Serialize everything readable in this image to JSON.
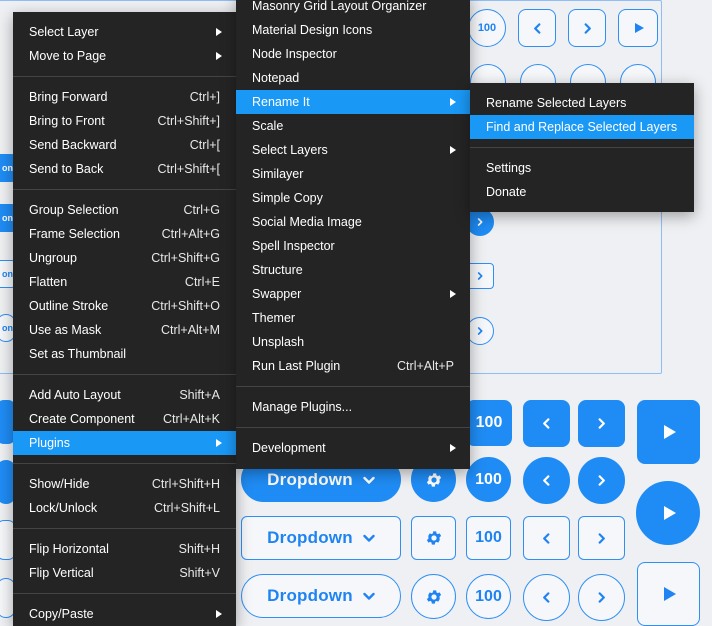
{
  "canvas": {
    "row1": {
      "num": "100"
    },
    "row3": {
      "dropdown": "Dropdown",
      "num": "100"
    },
    "row4": {
      "dropdown": "Dropdown",
      "num": "100"
    },
    "row5": {
      "dropdown": "Dropdown",
      "num": "100"
    },
    "partial_labels": [
      "on",
      "on",
      "on",
      "on"
    ],
    "accent_color": "#1f8cf5"
  },
  "context_menu": {
    "items": [
      {
        "label": "Select Layer",
        "shortcut": "",
        "submenu": true
      },
      {
        "label": "Move to Page",
        "shortcut": "",
        "submenu": true
      },
      {
        "sep": true
      },
      {
        "label": "Bring Forward",
        "shortcut": "Ctrl+]"
      },
      {
        "label": "Bring to Front",
        "shortcut": "Ctrl+Shift+]"
      },
      {
        "label": "Send Backward",
        "shortcut": "Ctrl+["
      },
      {
        "label": "Send to Back",
        "shortcut": "Ctrl+Shift+["
      },
      {
        "sep": true
      },
      {
        "label": "Group Selection",
        "shortcut": "Ctrl+G"
      },
      {
        "label": "Frame Selection",
        "shortcut": "Ctrl+Alt+G"
      },
      {
        "label": "Ungroup",
        "shortcut": "Ctrl+Shift+G"
      },
      {
        "label": "Flatten",
        "shortcut": "Ctrl+E"
      },
      {
        "label": "Outline Stroke",
        "shortcut": "Ctrl+Shift+O"
      },
      {
        "label": "Use as Mask",
        "shortcut": "Ctrl+Alt+M"
      },
      {
        "label": "Set as Thumbnail",
        "shortcut": ""
      },
      {
        "sep": true
      },
      {
        "label": "Add Auto Layout",
        "shortcut": "Shift+A"
      },
      {
        "label": "Create Component",
        "shortcut": "Ctrl+Alt+K"
      },
      {
        "label": "Plugins",
        "shortcut": "",
        "submenu": true,
        "active": true
      },
      {
        "sep": true
      },
      {
        "label": "Show/Hide",
        "shortcut": "Ctrl+Shift+H"
      },
      {
        "label": "Lock/Unlock",
        "shortcut": "Ctrl+Shift+L"
      },
      {
        "sep": true
      },
      {
        "label": "Flip Horizontal",
        "shortcut": "Shift+H"
      },
      {
        "label": "Flip Vertical",
        "shortcut": "Shift+V"
      },
      {
        "sep": true
      },
      {
        "label": "Copy/Paste",
        "shortcut": "",
        "submenu": true
      }
    ]
  },
  "plugins_menu": {
    "items": [
      {
        "label": "Masonry Grid Layout Organizer"
      },
      {
        "label": "Material Design Icons"
      },
      {
        "label": "Node Inspector"
      },
      {
        "label": "Notepad"
      },
      {
        "label": "Rename It",
        "submenu": true,
        "active": true
      },
      {
        "label": "Scale"
      },
      {
        "label": "Select Layers",
        "submenu": true
      },
      {
        "label": "Similayer"
      },
      {
        "label": "Simple Copy"
      },
      {
        "label": "Social Media Image"
      },
      {
        "label": "Spell Inspector"
      },
      {
        "label": "Structure"
      },
      {
        "label": "Swapper",
        "submenu": true
      },
      {
        "label": "Themer"
      },
      {
        "label": "Unsplash"
      },
      {
        "label": "Run Last Plugin",
        "shortcut": "Ctrl+Alt+P"
      },
      {
        "sep": true
      },
      {
        "label": "Manage Plugins..."
      },
      {
        "sep": true
      },
      {
        "label": "Development",
        "submenu": true
      }
    ]
  },
  "rename_menu": {
    "items": [
      {
        "label": "Rename Selected Layers"
      },
      {
        "label": "Find and Replace Selected Layers",
        "active": true
      },
      {
        "sep": true
      },
      {
        "label": "Settings"
      },
      {
        "label": "Donate"
      }
    ]
  }
}
